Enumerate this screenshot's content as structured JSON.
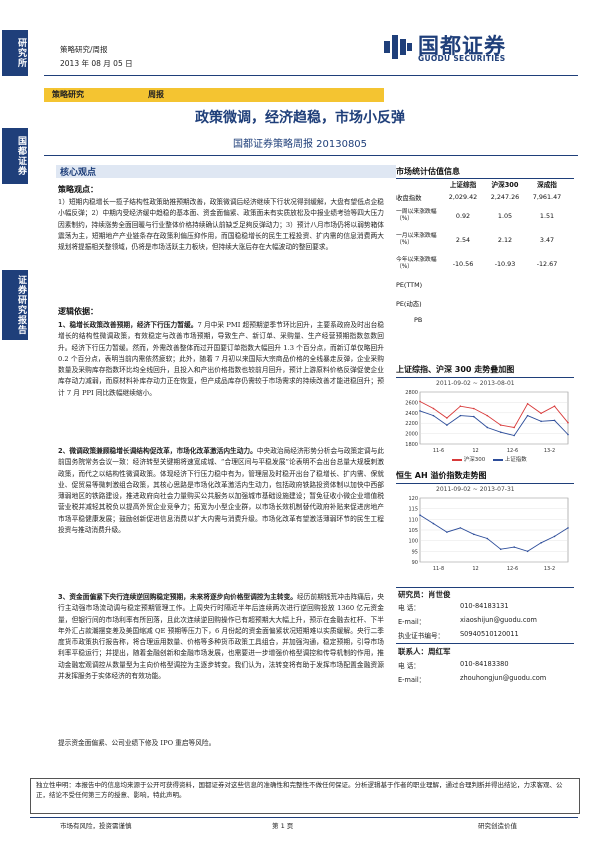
{
  "side": {
    "tab1": "研究所",
    "tab2": "国都证券",
    "tab3": "证券研究报告"
  },
  "header": {
    "category": "策略研究/周报",
    "date": "2013 年 08 月 05 日",
    "logo_cn": "国都证券",
    "logo_en": "GUODU SECURITIES",
    "bar_left": "策略研究",
    "bar_right": "周报"
  },
  "title": "政策微调，经济趋稳，市场小反弹",
  "subtitle": "国都证券策略周报 20130805",
  "core_view": "核心观点",
  "strategy_title": "策略观点：",
  "strategy_text": "1）短期内稳增长一揽子结构性政策助推预期改善，政策微调后经济继续下行状况得到缓解，大盘有望低点企稳小幅反弹；2）中期内受经济缓中趋稳的基本面、资金面偏紧、政策面未有实质放松及中报业绩考验等四大压力因素制约，持续涨势全面回暖与行业整体价格持续确认前缺乏足夠反弹动力；3）预计八月市场仍将以弱势箱体震荡为主，短期地产产业链条存在政策利偏压抑作用，而国稳稳增长的民生工程投资、扩内需的信息消费两大规划将提振相关整领域，仍将是市场活跃主力板块，但持续大涨后存在大幅波动的整回要求。",
  "logic_title": "逻辑依据：",
  "logic": [
    {
      "head": "1、稳增长政策改善预期，经济下行压力暂缓。",
      "text": "7 月中采 PMI 超预期逆季节环比回升，主要系政府及时出台稳增长的结构性微调政策，有效稳定与改善市场预期，导致生产、新订单、采购量、生产经营预期指数忽数回升。经济下行压力暂缓。然而，外需改善整体而过开国要订单指数大幅回升 1.3 个百分点，而新订单仅略回升 0.2 个百分点，表明当前内需依然疲软；此外，随着 7 月初以来国际大宗商品价格的全线暴走反弹，企业采购数量及采购库存指数环比均全线回升，且投入和产出价格指数也较前月回升，预计上游原料价格反弹促使企业库存动力减弱，而原材料补库存动力正在恢复，但产成品库存仍需较于市场需求的持续改善才能进稳回升；预计 7 月 PPI 同比跌幅继续缩小。"
    },
    {
      "head": "2、微调政策兼顾稳增长调结构促改革，市场化改革激活内生动力。",
      "text": "中央政治局经济形势分析会与政策定调与此前国务院常务会议一致：经济转型关键期将速宽成城、“合理区间与平稳发展”论表明不会出台总量大规模刺激政策，而代之以结构性微调政策。体现经济下行压力稳中有为，管理层及时稳开出台了稳增长、扩内需、保就业、促贸易等微刺激组合政策，其核心思路是市场化改革激活内生动力，包括政府铁路投资体制以加快中西部薄弱地区的铁路建设，推进政府向社会力量购买公共服务以加强城市基础设施建设；暂免征收小微企业增值税营业税并减轻其税负以提高外贸企业竞争力；拓宽为小型企业群，以市场长效机制替代政府补贴来促进房地产市场平稳健康发展；鼓励创新促进信息消费以扩大内需与消费升级。市场化改革有望激活薄弱环节的民生工程投资与推动消费升级。"
    },
    {
      "head": "3、资金面偏紧下央行连续逆回购稳定预期，未来将逐步向价格型调控为主转变。",
      "text": "经历前期钱荒冲击阵痛后，央行主动强市场流动调与稳定预期管理工作。上周央行时隔近半年后连续两次进行逆回购投放 1360 亿元资金量，但银行间的市场利率有所回落，且此次连续逆回购操作已有超预期大大幅上升，预示在金融去杠杆、下半年外汇占款潮摆变差及美国缩减 QE 预期等压力下，6 月份起的资金面偏紧状况短期难以实质缓解。央行二季度货币政策执行报告称，将合理运用数量、价格等多种货币政策工具组合，并加强沟通，稳定预期，引导市场利率平稳运行；并提出，随着金融创新和金融市场发展，也需要进一步增强价格型调控和传导机制的作用，推动金融宏观调控从数量型为主向价格型调控为主逐步转变。我们认为，法转变将有助于发挥市场配置金融资源并发挥服务于实体经济的有效功能。"
    }
  ],
  "risk": "提示资金面偏紧、公司业绩下修及 IPO 重启等风险。",
  "market_title": "市场统计估值信息",
  "market_headers": [
    "上证综指",
    "沪深300",
    "深成指"
  ],
  "market_rows": [
    {
      "label": "收盘指数",
      "v": [
        "2,029.42",
        "2,247.26",
        "7,961.47"
      ]
    },
    {
      "label": "一周以来涨跌幅（%）",
      "v": [
        "0.92",
        "1.05",
        "1.51"
      ]
    },
    {
      "label": "一月以来涨跌幅（%）",
      "v": [
        "2.54",
        "2.12",
        "3.47"
      ]
    },
    {
      "label": "今年以来涨跌幅（%）",
      "v": [
        "-10.56",
        "-10.93",
        "-12.67"
      ]
    },
    {
      "label": "PE(TTM)",
      "v": [
        "",
        "",
        ""
      ]
    },
    {
      "label": "PE(动态)",
      "v": [
        "",
        "",
        ""
      ]
    },
    {
      "label": "PB",
      "v": [
        "",
        "",
        ""
      ]
    }
  ],
  "chart1": {
    "title": "上证综指、沪深 300 走势叠加图",
    "caption": "2011-09-02 ~ 2013-08-01",
    "legend": [
      "沪深300",
      "上证指数"
    ],
    "ylabels": [
      "2800",
      "2600",
      "2400",
      "2200",
      "2000",
      "1800"
    ],
    "xlabels": [
      "11-6",
      "12",
      "12-6",
      "13-2"
    ]
  },
  "chart2": {
    "title": "恒生 AH 溢价指数走势图",
    "caption": "2011-09-02 ~ 2013-07-31",
    "ylabels": [
      "120",
      "115",
      "110",
      "105",
      "100",
      "95",
      "90"
    ],
    "xlabels": [
      "11-8",
      "12",
      "12-6",
      "13-2"
    ]
  },
  "chart_data": [
    {
      "type": "line",
      "title": "上证综指、沪深 300 走势叠加图",
      "xlabel": "",
      "ylabel": "",
      "x": [
        "2011-09",
        "2011-11",
        "2012-01",
        "2012-03",
        "2012-05",
        "2012-07",
        "2012-09",
        "2012-11",
        "2013-01",
        "2013-03",
        "2013-05",
        "2013-07"
      ],
      "ylim": [
        1800,
        2900
      ],
      "series": [
        {
          "name": "沪深300",
          "values": [
            2700,
            2550,
            2350,
            2600,
            2550,
            2400,
            2200,
            2150,
            2650,
            2450,
            2600,
            2250
          ]
        },
        {
          "name": "上证指数",
          "values": [
            2500,
            2400,
            2200,
            2400,
            2380,
            2150,
            2050,
            1980,
            2400,
            2280,
            2300,
            2000
          ]
        }
      ]
    },
    {
      "type": "line",
      "title": "恒生 AH 溢价指数走势图",
      "xlabel": "",
      "ylabel": "",
      "x": [
        "2011-09",
        "2011-11",
        "2012-01",
        "2012-03",
        "2012-05",
        "2012-07",
        "2012-09",
        "2012-11",
        "2013-01",
        "2013-03",
        "2013-05",
        "2013-07"
      ],
      "ylim": [
        90,
        120
      ],
      "series": [
        {
          "name": "AH溢价指数",
          "values": [
            112,
            108,
            104,
            106,
            103,
            101,
            96,
            97,
            95,
            99,
            102,
            106
          ]
        }
      ]
    }
  ],
  "analysts": {
    "r1_label": "研究员：肖世俊",
    "r1_tel_k": "电 话：",
    "r1_tel": "010-84183131",
    "r1_mail_k": "E-mail：",
    "r1_mail": "xiaoshijun@guodu.com",
    "r1_cert_k": "执业证书编号：",
    "r1_cert": "S0940510120011",
    "c_label": "联系人：周红军",
    "c_tel_k": "电 话：",
    "c_tel": "010-84183380",
    "c_mail_k": "E-mail：",
    "c_mail": "zhouhongjun@guodu.com"
  },
  "footer": {
    "disclaimer": "独立性申明：本报告中的信息均来源于公开可获得资料，国都证券对这些信息的准确性和完整性不做任何保证。分析逻辑基于作者的职业理解，通过合理判断并得出结论，力求客观、公正，结论不受任何第三方的授意、影响，特此声明。",
    "left": "市场有风险，投资需谨慎",
    "center": "第 1 页",
    "right": "研究创造价值"
  }
}
